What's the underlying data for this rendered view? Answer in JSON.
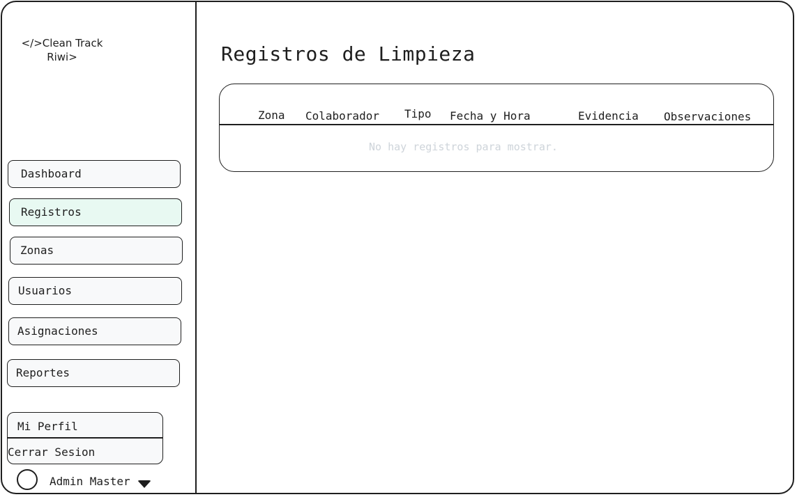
{
  "app": {
    "logo_line1": "</>Clean Track",
    "logo_line2": "Riwi>"
  },
  "sidebar": {
    "items": [
      {
        "label": "Dashboard",
        "active": false
      },
      {
        "label": "Registros",
        "active": true
      },
      {
        "label": "Zonas",
        "active": false
      },
      {
        "label": "Usuarios",
        "active": false
      },
      {
        "label": "Asignaciones",
        "active": false
      },
      {
        "label": "Reportes",
        "active": false
      }
    ],
    "profile_menu": {
      "profile_label": "Mi Perfil",
      "logout_label": "Cerrar Sesion"
    },
    "user": {
      "name": "Admin Master",
      "avatar_icon": "avatar-circle",
      "menu_icon": "chevron-down-icon"
    }
  },
  "main": {
    "title": "Registros de Limpieza",
    "table": {
      "columns": [
        "Zona",
        "Colaborador",
        "Tipo",
        "Fecha y Hora",
        "Evidencia",
        "Observaciones"
      ],
      "rows": [],
      "empty_message": "No hay registros para mostrar."
    }
  },
  "colors": {
    "stroke": "#1e1e1e",
    "active_nav_bg": "#e8f9f2",
    "nav_bg": "#f8f9fa",
    "empty_text": "#ced4da"
  }
}
